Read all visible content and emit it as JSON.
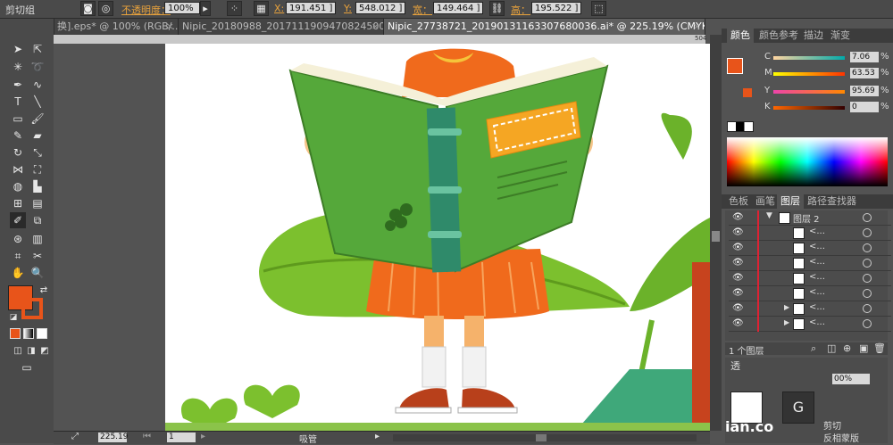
{
  "control_bar": {
    "group_label": "剪切组",
    "opacity_label": "不透明度：",
    "opacity_value": "100%",
    "x_label": "X:",
    "x_value": "191.451 ]",
    "y_label": "Y:",
    "y_value": "548.012 ]",
    "width_label": "宽：",
    "width_value": "149.464 ]",
    "height_label": "高：",
    "height_value": "195.522 ]"
  },
  "tabs": [
    {
      "label": "换].eps* @ 100% (RGB/..."
    },
    {
      "label": "Nipic_20180988_20171119094708245000.ai* @ 1..."
    },
    {
      "label": "Nipic_27738721_20190131163307680036.ai* @ 225.19% (CMYK/预览)"
    }
  ],
  "ruler_ticks": [
    "504"
  ],
  "status_bar": {
    "zoom": "225.19",
    "page": "1",
    "tool_name": "吸管"
  },
  "color_panel": {
    "tabs": [
      "颜色",
      "颜色参考",
      "描边",
      "渐变"
    ],
    "c_label": "C",
    "c_value": "7.06",
    "m_label": "M",
    "m_value": "63.53",
    "y_label": "Y",
    "y_value": "95.69",
    "k_label": "K",
    "k_value": "0",
    "pct": "%",
    "fill_color": "#e8541a"
  },
  "layers_panel": {
    "tabs": [
      "色板",
      "画笔",
      "图层",
      "路径查找器"
    ],
    "layer_name": "图层 2",
    "sublayer_label": "<...",
    "count_label": "1 个图层"
  },
  "transparency_panel": {
    "title": "透",
    "opacity_value": "00%",
    "mask_label": "反相蒙版",
    "clip_label": "剪切"
  },
  "watermark_text": "ian.co"
}
